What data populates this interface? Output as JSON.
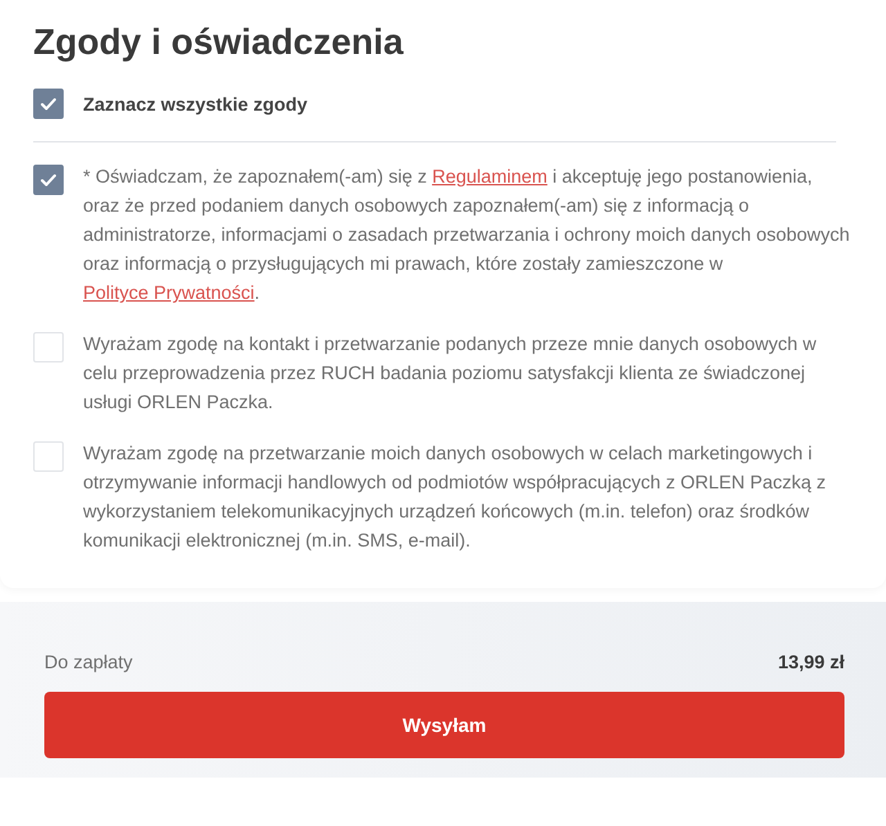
{
  "title": "Zgody i oświadczenia",
  "select_all": {
    "label": "Zaznacz wszystkie zgody",
    "checked": true
  },
  "consents": [
    {
      "checked": true,
      "parts": [
        {
          "text": "* Oświadczam, że zapoznałem(-am) się z "
        },
        {
          "link": "Regulaminem"
        },
        {
          "text": " i akceptuję jego postanowienia, oraz że przed podaniem danych osobowych zapoznałem(-am) się z informacją o administratorze, informacjami o zasadach przetwarzania i ochrony moich danych osobowych oraz informacją o przysługujących mi prawach, które zostały zamieszczone w "
        },
        {
          "link": "Polityce Prywatności"
        },
        {
          "text": "."
        }
      ]
    },
    {
      "checked": false,
      "parts": [
        {
          "text": "Wyrażam zgodę na kontakt i przetwarzanie podanych przeze mnie danych osobowych w celu przeprowadzenia przez RUCH badania poziomu satysfakcji klienta ze świadczonej usługi ORLEN Paczka."
        }
      ]
    },
    {
      "checked": false,
      "parts": [
        {
          "text": "Wyrażam zgodę na przetwarzanie moich danych osobowych w celach marketingowych i otrzymywanie informacji handlowych od podmiotów współpracujących z ORLEN Paczką z wykorzystaniem telekomunikacyjnych urządzeń końcowych (m.in. telefon) oraz środków komunikacji elektronicznej (m.in. SMS, e-mail)."
        }
      ]
    }
  ],
  "summary": {
    "label": "Do zapłaty",
    "amount": "13,99 zł"
  },
  "submit_button": "Wysyłam"
}
